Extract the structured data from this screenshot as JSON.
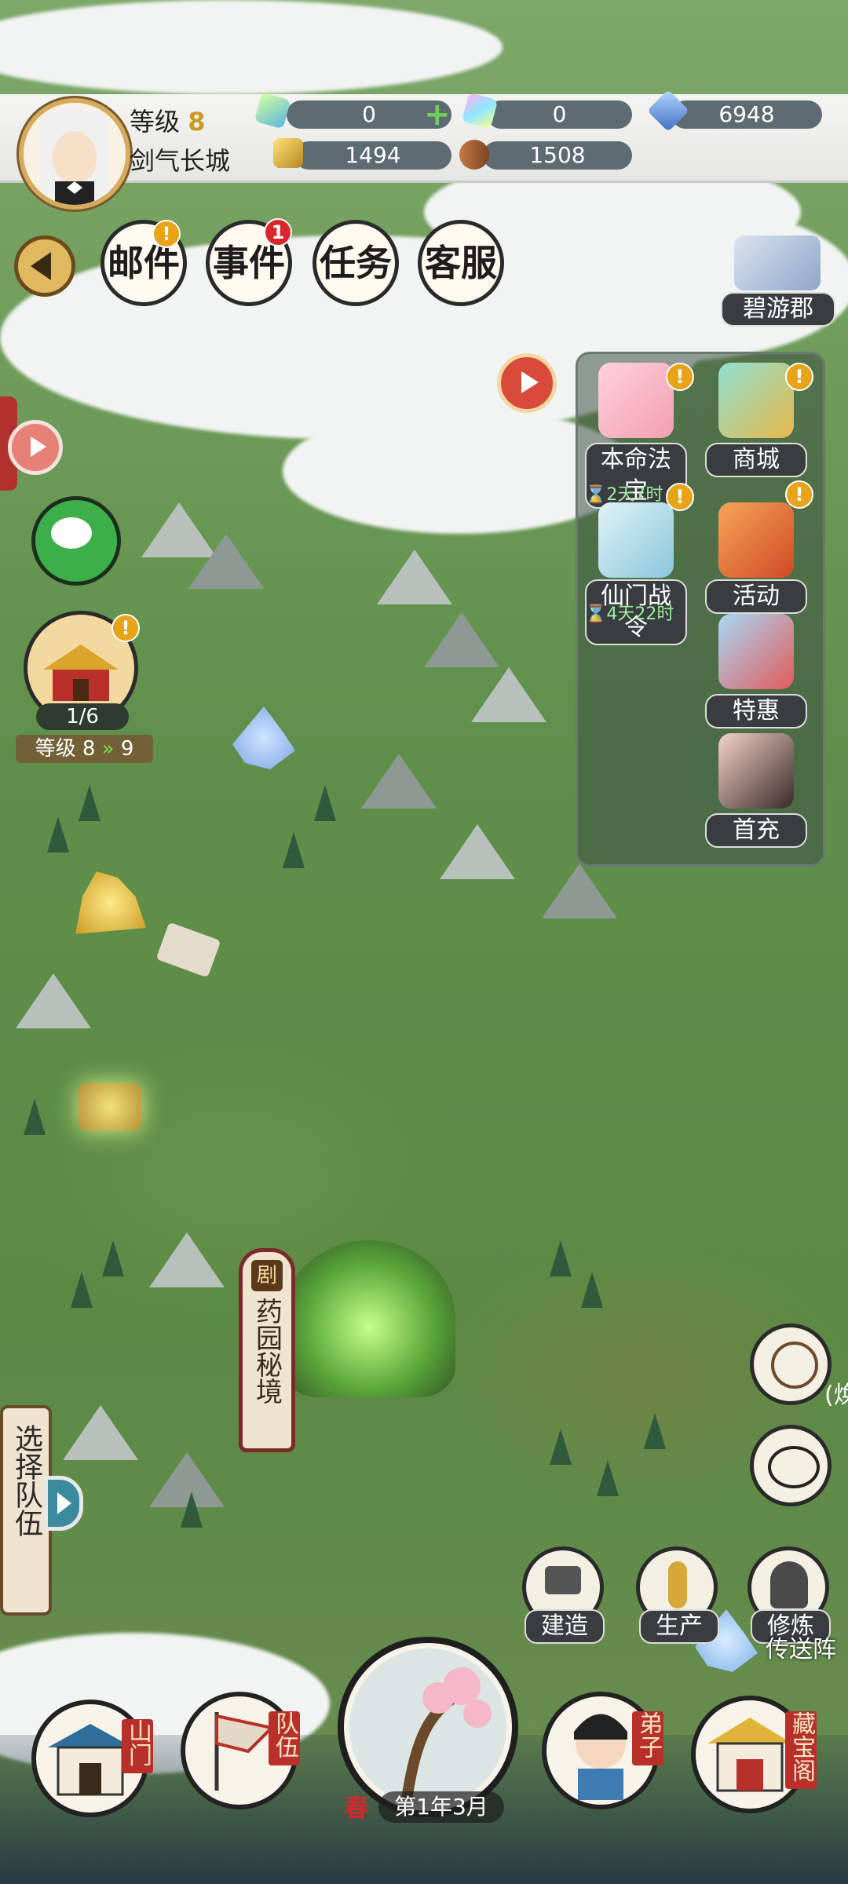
{
  "player": {
    "level_label": "等级",
    "level_value": "8",
    "name": "剑气长城"
  },
  "resources": [
    {
      "icon": "green-crystal-icon",
      "value": "0",
      "color": "#6fcf59"
    },
    {
      "icon": "rainbow-crystal-icon",
      "value": "0",
      "color": "#a6e3f0"
    },
    {
      "icon": "blue-gem-icon",
      "value": "6948",
      "color": "#5c8fd6"
    },
    {
      "icon": "gold-ore-icon",
      "value": "1494",
      "color": "#d8a73a"
    },
    {
      "icon": "wood-log-icon",
      "value": "1508",
      "color": "#9a5a32"
    }
  ],
  "top_menu": [
    {
      "label": "邮件",
      "badge": "!"
    },
    {
      "label": "事件",
      "badge": "1"
    },
    {
      "label": "任务",
      "badge": ""
    },
    {
      "label": "客服",
      "badge": ""
    }
  ],
  "region": "碧游郡",
  "side_panel": [
    {
      "label": "本命法宝",
      "badge": "!",
      "timer": ""
    },
    {
      "label": "商城",
      "badge": "!",
      "timer": ""
    },
    {
      "label": "仙门战令",
      "badge": "!",
      "timer": "2天7时"
    },
    {
      "label": "活动",
      "badge": "!",
      "timer": ""
    },
    {
      "label": "特惠",
      "badge": "",
      "timer": "4天22时"
    },
    {
      "label": "首充",
      "badge": "",
      "timer": ""
    }
  ],
  "sect": {
    "progress": "1/6",
    "level_label": "等级",
    "level_from": "8",
    "level_to": "9"
  },
  "map_label": "药园秘境",
  "map_tag": "剧",
  "team_select": "选择队伍",
  "actions": [
    {
      "label": "建造"
    },
    {
      "label": "生产"
    },
    {
      "label": "修炼"
    }
  ],
  "teleport_label": "传送阵",
  "partial_label": "(焕",
  "bottom_nav": [
    {
      "label": "山门"
    },
    {
      "label": "队伍"
    },
    {
      "label": "弟子"
    },
    {
      "label": "藏宝阁"
    }
  ],
  "season": {
    "name": "春",
    "date": "第1年3月"
  }
}
